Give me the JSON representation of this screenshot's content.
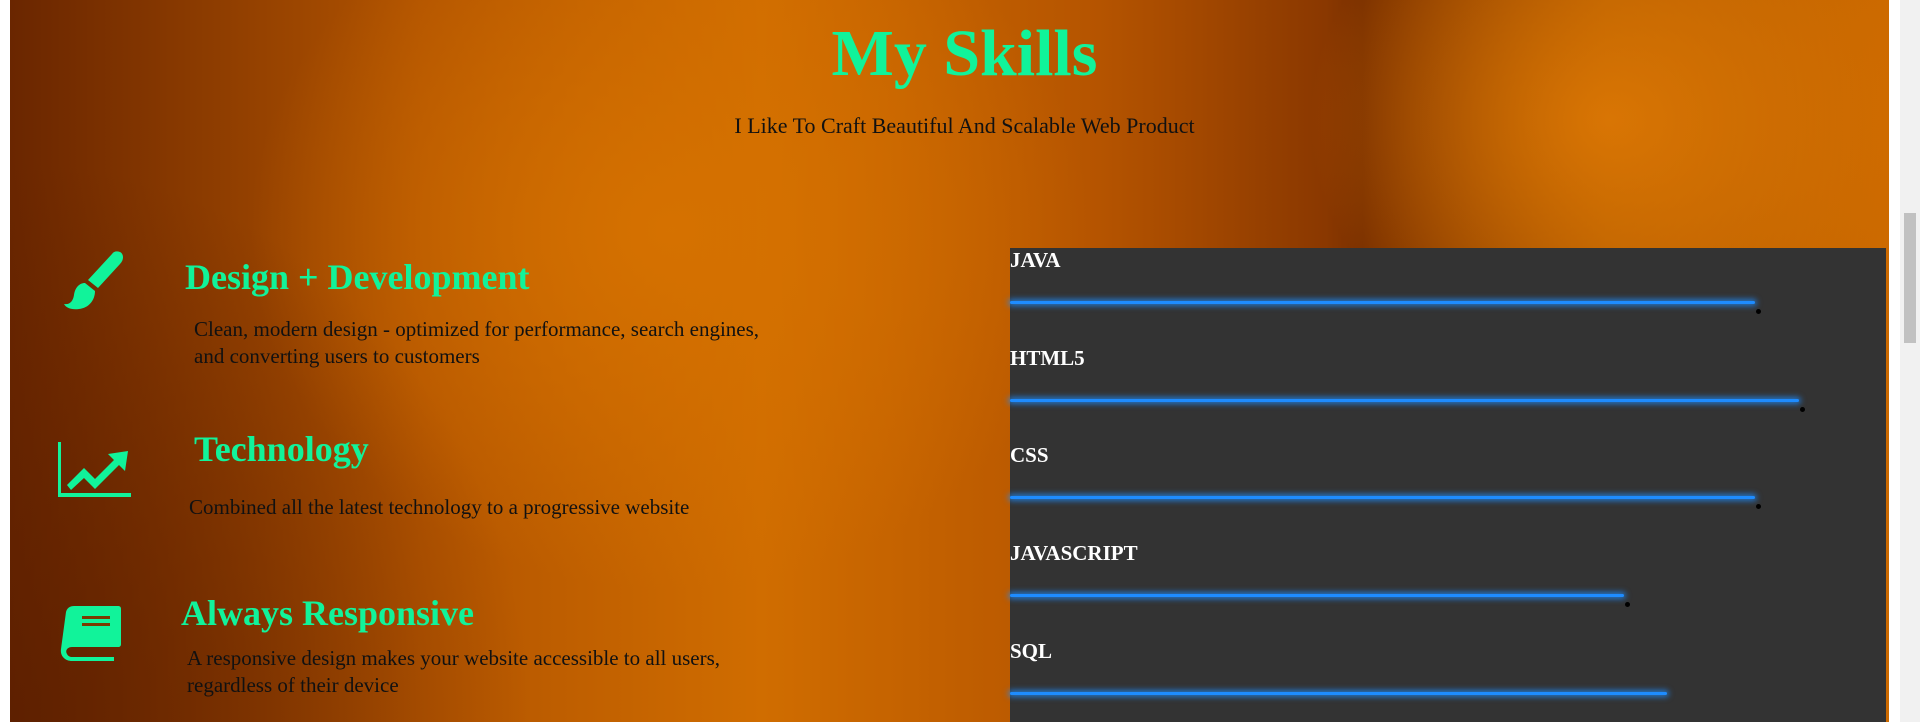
{
  "header": {
    "title": "My Skills",
    "subtitle": "I Like To Craft Beautiful And Scalable Web Product"
  },
  "features": [
    {
      "icon": "paint-brush-icon",
      "title": "Design + Development",
      "description": "Clean, modern design - optimized for performance, search engines, and converting users to customers"
    },
    {
      "icon": "chart-line-icon",
      "title": "Technology",
      "description": "Combined all the latest technology to a progressive website"
    },
    {
      "icon": "book-icon",
      "title": "Always Responsive",
      "description": "A responsive design makes your website accessible to all users, regardless of their device"
    }
  ],
  "skills": [
    {
      "name": "JAVA",
      "level": 85
    },
    {
      "name": "HTML5",
      "level": 90
    },
    {
      "name": "CSS",
      "level": 85
    },
    {
      "name": "JAVASCRIPT",
      "level": 70
    },
    {
      "name": "SQL",
      "level": 75
    }
  ],
  "colors": {
    "accent": "#11f39a",
    "skill_bar": "#1e8cff",
    "panel": "#333333"
  }
}
